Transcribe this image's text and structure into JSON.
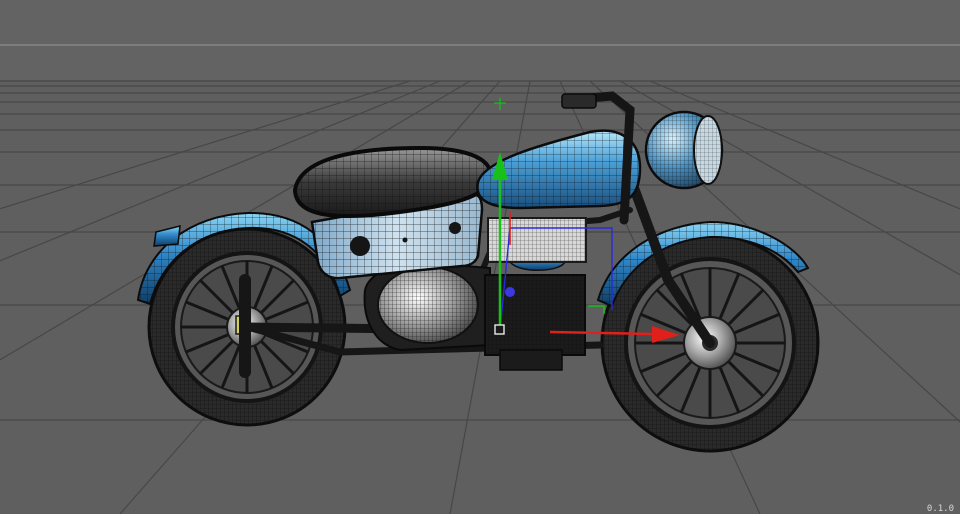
{
  "viewport": {
    "background": "#5e5e5e",
    "grid_color": "#4a4a4a",
    "horizon_color": "#8a8a8a",
    "corner_label": "0.1.0"
  },
  "gizmo": {
    "x_axis_color": "#e0201a",
    "y_axis_color": "#19c019",
    "z_axis_color": "#2a2ad8"
  },
  "model": {
    "paint_color": "#2f86c8",
    "paint_highlight": "#7fd0f2",
    "frame_color": "#1b1b1b",
    "chrome_color": "#c9c9c9"
  }
}
